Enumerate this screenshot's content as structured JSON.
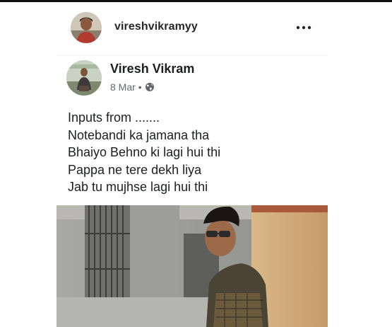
{
  "instagram_header": {
    "username": "vireshvikramyy",
    "more_icon": "more-horizontal-icon"
  },
  "post": {
    "author": "Viresh Vikram",
    "date": "8 Mar",
    "separator": "•",
    "privacy_icon": "globe-icon",
    "lines": [
      "Inputs from .......",
      "Notebandi ka jamana tha",
      "Bhaiyo Behno ki lagi hui thi",
      "Pappa ne tere dekh liya",
      "Jab tu mujhse lagi hui thi"
    ]
  },
  "colors": {
    "name_text": "#1c1e21",
    "meta_text": "#606770",
    "username_text": "#262626"
  }
}
